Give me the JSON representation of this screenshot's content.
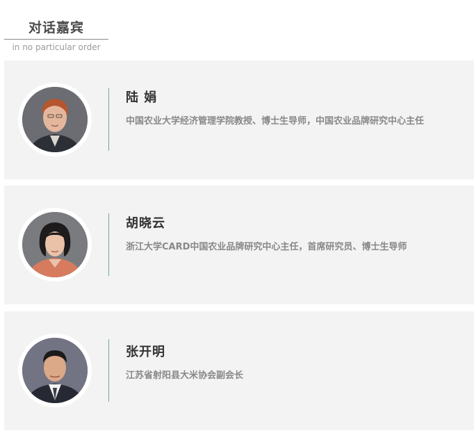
{
  "header": {
    "title": "对话嘉宾",
    "subtitle": "in no particular order"
  },
  "guests": [
    {
      "name": "陆 娟",
      "title": "中国农业大学经济管理学院教授、博士生导师，中国农业品牌研究中心主任"
    },
    {
      "name": "胡晓云",
      "title": "浙江大学CARD中国农业品牌研究中心主任，首席研究员、博士生导师"
    },
    {
      "name": "张开明",
      "title": "江苏省射阳县大米协会副会长"
    }
  ],
  "colors": {
    "card_background": "#f3f3f3",
    "divider_accent": "#6aa7a4",
    "name_text": "#333333",
    "title_text": "#888888"
  }
}
